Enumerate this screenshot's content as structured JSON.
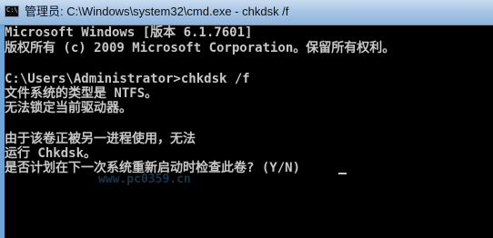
{
  "window": {
    "title": "管理员: C:\\Windows\\system32\\cmd.exe - chkdsk  /f"
  },
  "console": {
    "lines": [
      "Microsoft Windows [版本 6.1.7601]",
      "版权所有 (c) 2009 Microsoft Corporation。保留所有权利。",
      "",
      "C:\\Users\\Administrator>chkdsk /f",
      "文件系统的类型是 NTFS。",
      "无法锁定当前驱动器。",
      "",
      "由于该卷正被另一进程使用，无法",
      "运行 Chkdsk。",
      "是否计划在下一次系统重新启动时检查此卷? (Y/N) "
    ]
  },
  "watermark": {
    "text": "www.pc0359.cn"
  },
  "colors": {
    "console_background": "#000000",
    "console_text": "#c7c7c7",
    "titlebar": "#a9c6e6"
  },
  "icons": {
    "app_icon": "cmd-icon"
  }
}
